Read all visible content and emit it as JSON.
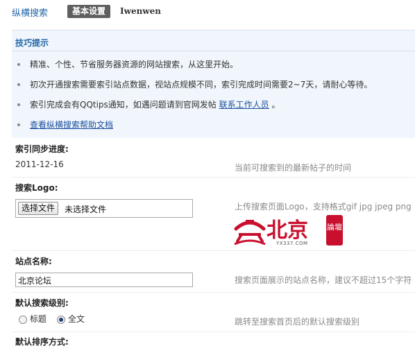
{
  "tabs": {
    "main": "纵横搜索",
    "active": "基本设置",
    "user": "Iwenwen"
  },
  "tips": {
    "title": "技巧提示",
    "items": [
      "精准、个性、节省服务器资源的网站搜索，从这里开始。",
      "初次开通搜索需要索引站点数据，视站点规模不同，索引完成时间需要2~7天，请耐心等待。",
      "索引完成会有QQtips通知，如遇问题请到官网发帖"
    ],
    "contact_link": "联系工作人员",
    "contact_suffix": "。",
    "help_link": "查看纵横搜索帮助文档"
  },
  "index_progress": {
    "label": "索引同步进度:",
    "value": "2011-12-16",
    "hint": "当前可搜索到的最新帖子的时间"
  },
  "logo_setting": {
    "label": "搜索Logo:",
    "file_button": "选择文件",
    "file_status": "未选择文件",
    "hint": "上传搜索页面Logo，支持格式gif jpg jpeg png",
    "logo_text": "北京",
    "logo_badge": "論壇",
    "logo_domain": "YX337.COM"
  },
  "site_name": {
    "label": "站点名称:",
    "value": "北京论坛",
    "hint": "搜索页面展示的站点名称，建议不超过15个字符"
  },
  "search_level": {
    "label": "默认搜索级别:",
    "options": [
      "标题",
      "全文"
    ],
    "selected": "全文",
    "hint": "跳转至搜索首页后的默认搜索级别"
  },
  "sort_method": {
    "label": "默认排序方式:"
  },
  "colors": {
    "accent": "#2366a8",
    "tips_bg": "#f0f6fb",
    "logo_red": "#c8102e"
  }
}
